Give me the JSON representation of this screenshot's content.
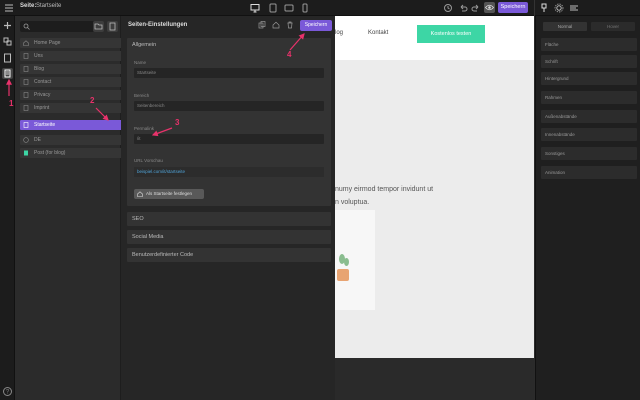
{
  "topbar": {
    "page_label": "Seite:",
    "page_name": "Startseite",
    "save_label": "Speichern"
  },
  "pages_panel": {
    "items": [
      {
        "label": "Home Page",
        "icon": "home-icon"
      },
      {
        "label": "Uns",
        "icon": "page-icon"
      },
      {
        "label": "Blog",
        "icon": "page-icon"
      },
      {
        "label": "Contact",
        "icon": "page-icon"
      },
      {
        "label": "Privacy",
        "icon": "page-icon"
      },
      {
        "label": "Imprint",
        "icon": "page-icon"
      },
      {
        "label": "Startseite",
        "icon": "page-icon",
        "selected": true
      },
      {
        "label": "DE",
        "icon": "globe-icon"
      },
      {
        "label": "Post (for blog)",
        "icon": "post-icon"
      }
    ]
  },
  "settings_panel": {
    "title": "Seiten-Einstellungen",
    "save_label": "Speichern",
    "general_title": "Allgemein",
    "name_label": "Name",
    "name_value": "Startseite",
    "seo_label": "Bereich",
    "seo_value": "Seitenbereich",
    "permalink_label": "Permalink",
    "permalink_value": "/it",
    "url_label": "URL Vorschau",
    "url_value": "beispiel.com/it/startseite",
    "set_start_label": "Als Startseite festlegen",
    "sections": [
      "SEO",
      "Social Media",
      "Benutzerdefinierter Code"
    ]
  },
  "canvas": {
    "nav_links": [
      "log",
      "Kontakt"
    ],
    "cta_label": "Kostenlos testen",
    "hero_line1": "numy eirmod tempor invidunt ut",
    "hero_line2": "n voluptua."
  },
  "style_panel": {
    "tabs": [
      "Normal",
      "Hover"
    ],
    "items": [
      "Fläche",
      "Schrift",
      "Hintergrund",
      "Rahmen",
      "Außenabstände",
      "Innenabstände",
      "Sonstiges",
      "Animation"
    ]
  },
  "annotations": [
    "1",
    "2",
    "3",
    "4"
  ],
  "colors": {
    "accent": "#7a59d8",
    "cta": "#3dd6a5",
    "annotation": "#e8326b",
    "link": "#4fa3d8"
  }
}
